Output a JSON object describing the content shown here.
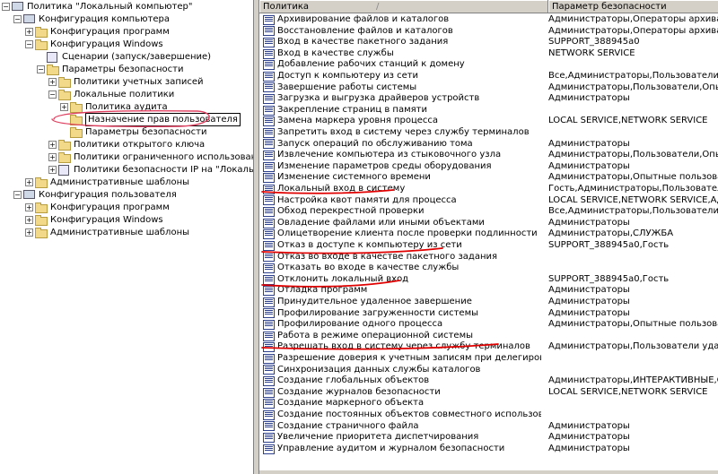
{
  "tree": {
    "items": [
      {
        "label": "Политика \"Локальный компьютер\"",
        "icon": "computer-icon"
      },
      {
        "label": "Конфигурация компьютера",
        "icon": "computer-icon"
      },
      {
        "label": "Конфигурация программ",
        "icon": "folder-icon"
      },
      {
        "label": "Конфигурация Windows",
        "icon": "folder-icon"
      },
      {
        "label": "Сценарии (запуск/завершение)",
        "icon": "document-icon"
      },
      {
        "label": "Параметры безопасности",
        "icon": "folder-icon"
      },
      {
        "label": "Политики учетных записей",
        "icon": "folder-icon"
      },
      {
        "label": "Локальные политики",
        "icon": "folder-icon"
      },
      {
        "label": "Политика аудита",
        "icon": "folder-icon"
      },
      {
        "label": "Назначение прав пользователя",
        "icon": "folder-icon"
      },
      {
        "label": "Параметры безопасности",
        "icon": "folder-icon"
      },
      {
        "label": "Политики открытого ключа",
        "icon": "folder-icon"
      },
      {
        "label": "Политики ограниченного использования програ",
        "icon": "folder-icon"
      },
      {
        "label": "Политики безопасности IP на \"Локальный компь",
        "icon": "policy-icon"
      },
      {
        "label": "Административные шаблоны",
        "icon": "folder-icon"
      },
      {
        "label": "Конфигурация пользователя",
        "icon": "computer-icon"
      },
      {
        "label": "Конфигурация программ",
        "icon": "folder-icon"
      },
      {
        "label": "Конфигурация Windows",
        "icon": "folder-icon"
      },
      {
        "label": "Административные шаблоны",
        "icon": "folder-icon"
      }
    ]
  },
  "list": {
    "headers": {
      "policy": "Политика",
      "sort_glyph": "/",
      "setting": "Параметр безопасности"
    },
    "rows": [
      {
        "policy": "Архивирование файлов и каталогов",
        "setting": "Администраторы,Операторы архива"
      },
      {
        "policy": "Восстановление файлов и каталогов",
        "setting": "Администраторы,Операторы архива"
      },
      {
        "policy": "Вход в качестве пакетного задания",
        "setting": "SUPPORT_388945a0"
      },
      {
        "policy": "Вход в качестве службы",
        "setting": "NETWORK SERVICE"
      },
      {
        "policy": "Добавление рабочих станций к домену",
        "setting": ""
      },
      {
        "policy": "Доступ к компьютеру из сети",
        "setting": "Все,Администраторы,Пользователи,Оп..."
      },
      {
        "policy": "Завершение работы системы",
        "setting": "Администраторы,Пользователи,Опыт..."
      },
      {
        "policy": "Загрузка и выгрузка драйверов устройств",
        "setting": "Администраторы"
      },
      {
        "policy": "Закрепление страниц в памяти",
        "setting": ""
      },
      {
        "policy": "Замена маркера уровня процесса",
        "setting": "LOCAL SERVICE,NETWORK SERVICE"
      },
      {
        "policy": "Запретить вход в систему через службу терминалов",
        "setting": ""
      },
      {
        "policy": "Запуск операций по обслуживанию тома",
        "setting": "Администраторы"
      },
      {
        "policy": "Извлечение компьютера из стыковочного узла",
        "setting": "Администраторы,Пользователи,Опыт..."
      },
      {
        "policy": "Изменение параметров среды оборудования",
        "setting": "Администраторы"
      },
      {
        "policy": "Изменение системного времени",
        "setting": "Администраторы,Опытные пользовате..."
      },
      {
        "policy": "Локальный вход в систему",
        "setting": "Гость,Администраторы,Пользователи,..."
      },
      {
        "policy": "Настройка квот памяти для процесса",
        "setting": "LOCAL SERVICE,NETWORK SERVICE,Ад..."
      },
      {
        "policy": "Обход перекрестной проверки",
        "setting": "Все,Администраторы,Пользователи,Оп..."
      },
      {
        "policy": "Овладение файлами или иными объектами",
        "setting": "Администраторы"
      },
      {
        "policy": "Олицетворение клиента после проверки подлинности",
        "setting": "Администраторы,СЛУЖБА"
      },
      {
        "policy": "Отказ в доступе к компьютеру из сети",
        "setting": "SUPPORT_388945a0,Гость"
      },
      {
        "policy": "Отказ во входе в качестве пакетного задания",
        "setting": ""
      },
      {
        "policy": "Отказать во входе в качестве службы",
        "setting": ""
      },
      {
        "policy": "Отклонить локальный вход",
        "setting": "SUPPORT_388945a0,Гость"
      },
      {
        "policy": "Отладка программ",
        "setting": "Администраторы"
      },
      {
        "policy": "Принудительное удаленное завершение",
        "setting": "Администраторы"
      },
      {
        "policy": "Профилирование загруженности системы",
        "setting": "Администраторы"
      },
      {
        "policy": "Профилирование одного процесса",
        "setting": "Администраторы,Опытные пользовате..."
      },
      {
        "policy": "Работа в режиме операционной системы",
        "setting": ""
      },
      {
        "policy": "Разрешать вход в систему через службу терминалов",
        "setting": "Администраторы,Пользователи удале..."
      },
      {
        "policy": "Разрешение доверия к учетным записям при делегировании",
        "setting": ""
      },
      {
        "policy": "Синхронизация данных службы каталогов",
        "setting": ""
      },
      {
        "policy": "Создание глобальных объектов",
        "setting": "Администраторы,ИНТЕРАКТИВНЫЕ,СЛУ..."
      },
      {
        "policy": "Создание журналов безопасности",
        "setting": "LOCAL SERVICE,NETWORK SERVICE"
      },
      {
        "policy": "Создание маркерного объекта",
        "setting": ""
      },
      {
        "policy": "Создание постоянных объектов совместного использования",
        "setting": ""
      },
      {
        "policy": "Создание страничного файла",
        "setting": "Администраторы"
      },
      {
        "policy": "Увеличение приоритета диспетчирования",
        "setting": "Администраторы"
      },
      {
        "policy": "Управление аудитом и журналом безопасности",
        "setting": "Администраторы"
      }
    ]
  },
  "colors": {
    "annotation": "#e00000",
    "selection_circle": "#e04060",
    "background": "#ffffff",
    "chrome": "#d4d0c8"
  }
}
